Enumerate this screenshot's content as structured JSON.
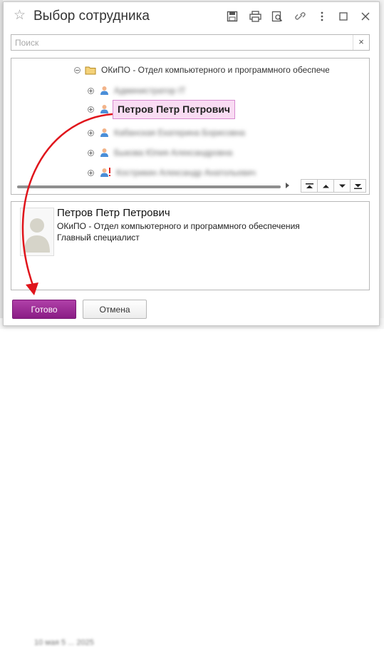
{
  "window": {
    "title": "Выбор сотрудника",
    "toolbar": [
      {
        "icon": "save-icon"
      },
      {
        "icon": "print-icon"
      },
      {
        "icon": "preview-icon"
      },
      {
        "icon": "link-icon"
      },
      {
        "icon": "more-icon"
      },
      {
        "icon": "maximize-icon"
      },
      {
        "icon": "close-icon"
      }
    ]
  },
  "search": {
    "placeholder": "Поиск",
    "value": "",
    "clear_label": "×"
  },
  "tree": {
    "parent": {
      "label": "ОКиПО - Отдел компьютерного и программного обеспечения"
    },
    "items": [
      {
        "label": "Администратор IT",
        "state": "blurred"
      },
      {
        "label": "Петров Петр Петрович",
        "state": "selected"
      },
      {
        "label": "Кабанская Екатерина Борисовна",
        "state": "blurred"
      },
      {
        "label": "Быкова Юлия Александровна",
        "state": "blurred"
      },
      {
        "label": "Кострикин Александр Анатольевич",
        "state": "blurred",
        "warning": true
      }
    ]
  },
  "card": {
    "name": "Петров Петр Петрович",
    "department": "ОКиПО - Отдел компьютерного и программного обеспечения",
    "position": "Главный специалист"
  },
  "buttons": {
    "ok": "Готово",
    "cancel": "Отмена"
  },
  "background": {
    "footer_text": "10 мая 5 ... 2025"
  },
  "colors": {
    "accent": "#9b2c95",
    "selection": "#f9dcf3",
    "arrow": "#e0141b"
  }
}
